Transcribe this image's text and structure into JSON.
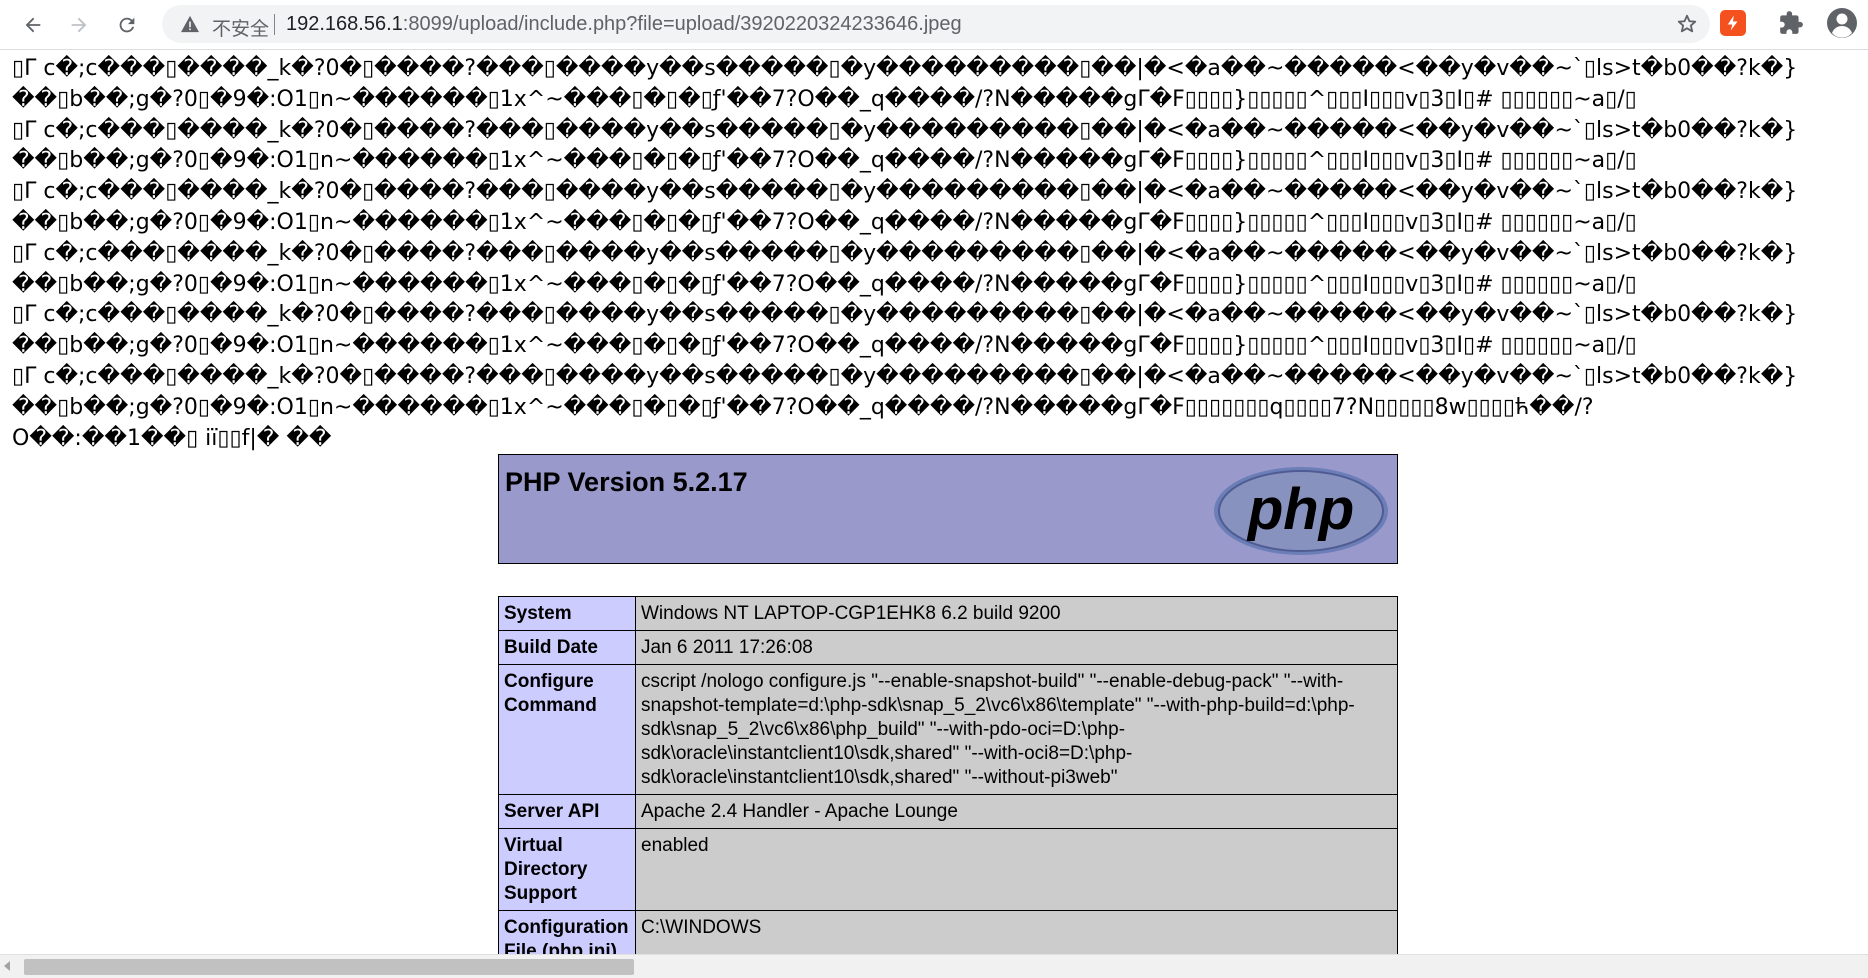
{
  "browser": {
    "security_label": "不安全",
    "url_host": "192.168.56.1",
    "url_rest": ":8099/upload/include.php?file=upload/3920220324233646.jpeg"
  },
  "garbled_lines": [
    "▯Γ c�;c���▯����_k�?0�▯����?���▯����y��s�����▯�y���������▯��|�<�a��~�����<��y�v��~`▯ls>t�b0��?k�}",
    "��▯b��;g�?0▯�9�:O1▯n~������▯1x^~���▯�▯�▯ƒ'��7?O��_q����/?N�����gΓ�F▯▯▯▯}▯▯▯▯▯^▯▯▯I▯▯▯v▯3▯I▯# ▯▯▯▯▯▯~a▯/▯",
    "▯Γ c�;c���▯����_k�?0�▯����?���▯����y��s�����▯�y���������▯��|�<�a��~�����<��y�v��~`▯ls>t�b0��?k�}",
    "��▯b��;g�?0▯�9�:O1▯n~������▯1x^~���▯�▯�▯ƒ'��7?O��_q����/?N�����gΓ�F▯▯▯▯}▯▯▯▯▯^▯▯▯I▯▯▯v▯3▯I▯# ▯▯▯▯▯▯~a▯/▯",
    "▯Γ c�;c���▯����_k�?0�▯����?���▯����y��s�����▯�y���������▯��|�<�a��~�����<��y�v��~`▯ls>t�b0��?k�}",
    "��▯b��;g�?0▯�9�:O1▯n~������▯1x^~���▯�▯�▯ƒ'��7?O��_q����/?N�����gΓ�F▯▯▯▯}▯▯▯▯▯^▯▯▯I▯▯▯v▯3▯I▯# ▯▯▯▯▯▯~a▯/▯",
    "▯Γ c�;c���▯����_k�?0�▯����?���▯����y��s�����▯�y���������▯��|�<�a��~�����<��y�v��~`▯ls>t�b0��?k�}",
    "��▯b��;g�?0▯�9�:O1▯n~������▯1x^~���▯�▯�▯ƒ'��7?O��_q����/?N�����gΓ�F▯▯▯▯}▯▯▯▯▯^▯▯▯I▯▯▯v▯3▯I▯# ▯▯▯▯▯▯~a▯/▯",
    "▯Γ c�;c���▯����_k�?0�▯����?���▯����y��s�����▯�y���������▯��|�<�a��~�����<��y�v��~`▯ls>t�b0��?k�}",
    "��▯b��;g�?0▯�9�:O1▯n~������▯1x^~���▯�▯�▯ƒ'��7?O��_q����/?N�����gΓ�F▯▯▯▯}▯▯▯▯▯^▯▯▯I▯▯▯v▯3▯I▯# ▯▯▯▯▯▯~a▯/▯",
    "▯Γ c�;c���▯����_k�?0�▯����?���▯����y��s�����▯�y���������▯��|�<�a��~�����<��y�v��~`▯ls>t�b0��?k�}",
    "��▯b��;g�?0▯�9�:O1▯n~������▯1x^~���▯�▯�▯ƒ'��7?O��_q����/?N�����gΓ�F▯▯▯▯▯▯▯q▯▯▯▯7?N▯▯▯▯▯8w▯▯▯▯ћ��/?",
    "O��:��1��▯ iї▯▯f|� ��"
  ],
  "phpinfo": {
    "version_title": "PHP Version 5.2.17",
    "logo_text": "php",
    "rows": [
      {
        "key": "System",
        "value": "Windows NT LAPTOP-CGP1EHK8 6.2 build 9200"
      },
      {
        "key": "Build Date",
        "value": "Jan 6 2011 17:26:08"
      },
      {
        "key": "Configure Command",
        "value": "cscript /nologo configure.js \"--enable-snapshot-build\" \"--enable-debug-pack\" \"--with-snapshot-template=d:\\php-sdk\\snap_5_2\\vc6\\x86\\template\" \"--with-php-build=d:\\php-sdk\\snap_5_2\\vc6\\x86\\php_build\" \"--with-pdo-oci=D:\\php-sdk\\oracle\\instantclient10\\sdk,shared\" \"--with-oci8=D:\\php-sdk\\oracle\\instantclient10\\sdk,shared\" \"--without-pi3web\""
      },
      {
        "key": "Server API",
        "value": "Apache 2.4 Handler - Apache Lounge"
      },
      {
        "key": "Virtual Directory Support",
        "value": "enabled"
      },
      {
        "key": "Configuration File (php.ini)",
        "value": "C:\\WINDOWS"
      }
    ]
  },
  "colors": {
    "php_header_bg": "#9999cc",
    "php_key_bg": "#ccccff",
    "php_value_bg": "#cccccc",
    "extension_accent": "#f4511e"
  },
  "icons": [
    "back-arrow-icon",
    "forward-arrow-icon",
    "reload-icon",
    "warning-icon",
    "star-icon",
    "extension-icon",
    "puzzle-icon",
    "profile-icon"
  ]
}
